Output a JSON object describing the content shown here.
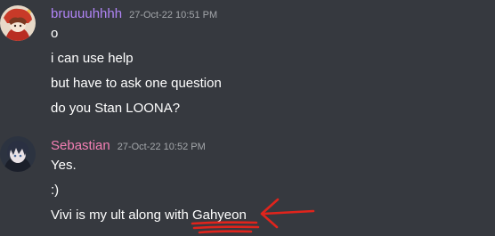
{
  "messages": [
    {
      "username": "bruuuuhhhh",
      "username_color": "#b084f5",
      "timestamp": "27-Oct-22 10:51 PM",
      "lines": [
        "o",
        "i can use help",
        "but have to ask one question",
        "do you Stan LOONA?"
      ]
    },
    {
      "username": "Sebastian",
      "username_color": "#f47fb4",
      "timestamp": "27-Oct-22 10:52 PM",
      "lines": [
        "Yes.",
        ":)",
        "Vivi is my ult along with Gahyeon"
      ]
    }
  ],
  "colors": {
    "background": "#36393f",
    "message_text": "#ffffff",
    "timestamp": "#a3a6aa",
    "annotation": "#e0241c"
  },
  "icons": [
    "avatar-bruuuuhhhh",
    "avatar-sebastian",
    "red-arrow-annotation",
    "red-underline-annotation"
  ]
}
